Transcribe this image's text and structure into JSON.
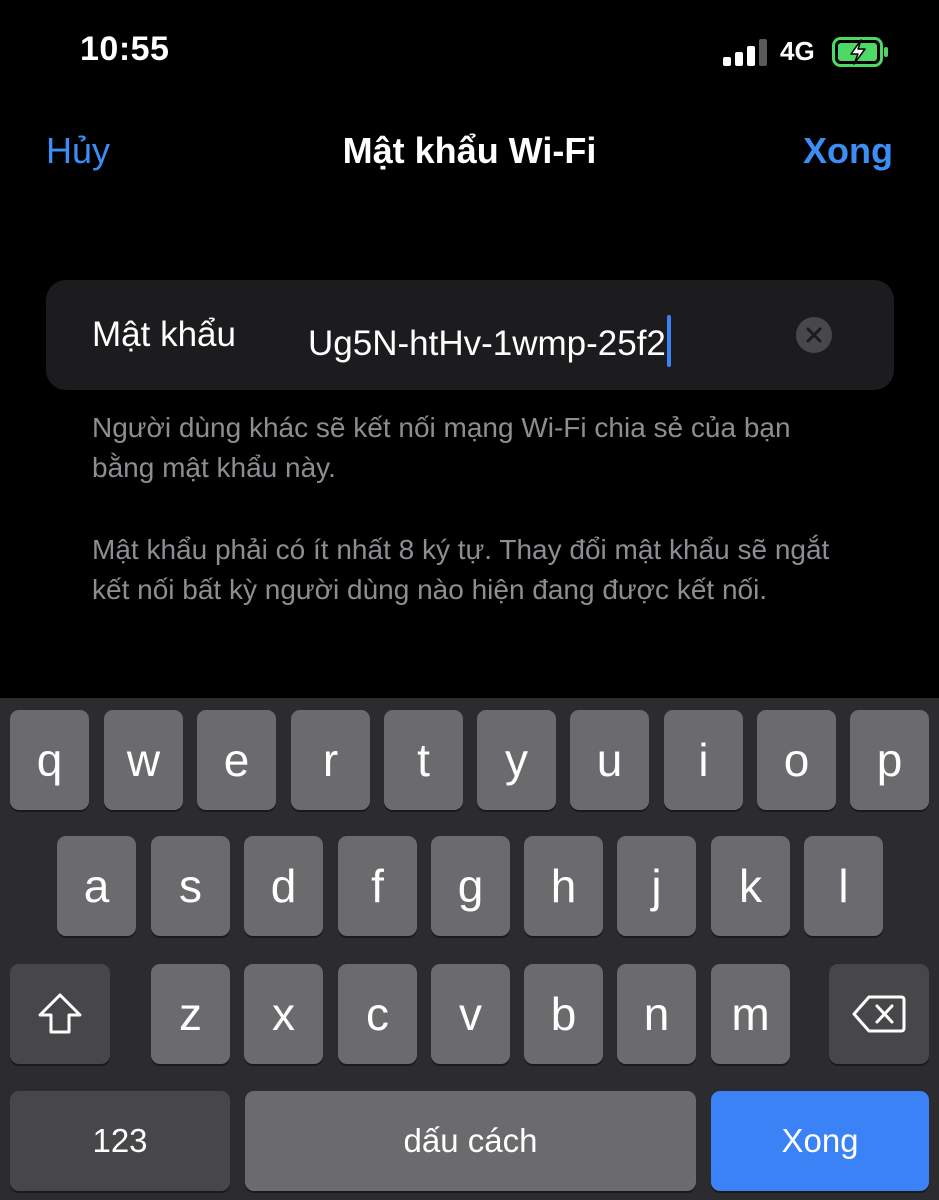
{
  "status_bar": {
    "time": "10:55",
    "network": "4G"
  },
  "nav": {
    "cancel": "Hủy",
    "title": "Mật khẩu Wi-Fi",
    "done": "Xong"
  },
  "field": {
    "label": "Mật khẩu",
    "value": "Ug5N-htHv-1wmp-25f2"
  },
  "notes": [
    "Người dùng khác sẽ kết nối mạng Wi-Fi chia sẻ của bạn bằng mật khẩu này.",
    "Mật khẩu phải có ít nhất 8 ký tự. Thay đổi mật khẩu sẽ ngắt kết nối bất kỳ người dùng nào hiện đang được kết nối."
  ],
  "keyboard": {
    "row1": [
      "q",
      "w",
      "e",
      "r",
      "t",
      "y",
      "u",
      "i",
      "o",
      "p"
    ],
    "row2": [
      "a",
      "s",
      "d",
      "f",
      "g",
      "h",
      "j",
      "k",
      "l"
    ],
    "row3": [
      "z",
      "x",
      "c",
      "v",
      "b",
      "n",
      "m"
    ],
    "numbers": "123",
    "space": "dấu cách",
    "go": "Xong"
  },
  "colors": {
    "accent": "#3b8ef6",
    "battery_charging": "#4cd964",
    "key": "#6b6b6e",
    "key_dark": "#47474a"
  },
  "icons": [
    "signal-icon",
    "battery-charging-icon",
    "clear-icon",
    "shift-icon",
    "backspace-icon"
  ]
}
